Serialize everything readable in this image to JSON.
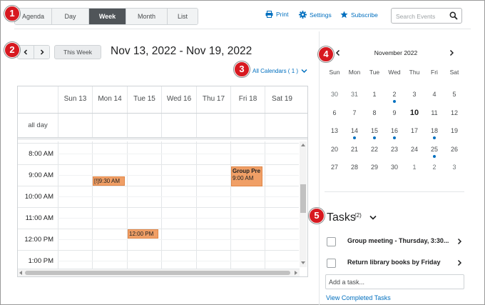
{
  "toolbar": {
    "views": [
      "Agenda",
      "Day",
      "Week",
      "Month",
      "List"
    ],
    "active_view": "Week",
    "print_label": "Print",
    "settings_label": "Settings",
    "subscribe_label": "Subscribe",
    "search_placeholder": "Search Events"
  },
  "nav": {
    "this_week_label": "This Week",
    "date_range": "Nov 13, 2022 - Nov 19, 2022",
    "all_calendars_label": "All Calendars ( 1 )"
  },
  "week": {
    "days": [
      "Sun 13",
      "Mon 14",
      "Tue 15",
      "Wed 16",
      "Thu 17",
      "Fri 18",
      "Sat 19"
    ],
    "all_day_label": "all day",
    "times": [
      "8:00 AM",
      "9:00 AM",
      "10:00 AM",
      "11:00 AM",
      "12:00 PM",
      "1:00 PM"
    ],
    "events": [
      {
        "day": "Mon 14",
        "label": "[!]9:30 AM"
      },
      {
        "day": "Tue 15",
        "label": "12:00 PM"
      },
      {
        "day": "Fri 18",
        "title": "Group Pre",
        "time": "9:00 AM"
      }
    ]
  },
  "mini_calendar": {
    "title": "November 2022",
    "weekdays": [
      "Sun",
      "Mon",
      "Tue",
      "Wed",
      "Thu",
      "Fri",
      "Sat"
    ],
    "weeks": [
      [
        "30",
        "31",
        "1",
        "2",
        "3",
        "4",
        "5"
      ],
      [
        "6",
        "7",
        "8",
        "9",
        "10",
        "11",
        "12"
      ],
      [
        "13",
        "14",
        "15",
        "16",
        "17",
        "18",
        "19"
      ],
      [
        "20",
        "21",
        "22",
        "23",
        "24",
        "25",
        "26"
      ],
      [
        "27",
        "28",
        "29",
        "30",
        "1",
        "2",
        "3"
      ]
    ],
    "today": "10",
    "event_days": [
      "2",
      "14",
      "15",
      "16",
      "18",
      "25"
    ]
  },
  "tasks": {
    "title": "Tasks",
    "count": "(2)",
    "items": [
      "Group meeting - Thursday, 3:30...",
      "Return library books by Friday"
    ],
    "add_placeholder": "Add a task...",
    "view_completed_label": "View Completed Tasks"
  },
  "callouts": [
    "1",
    "2",
    "3",
    "4",
    "5"
  ],
  "colors": {
    "accent": "#006fbf",
    "event": "#f09f66",
    "active_tab": "#505559",
    "callout": "#d71920"
  }
}
